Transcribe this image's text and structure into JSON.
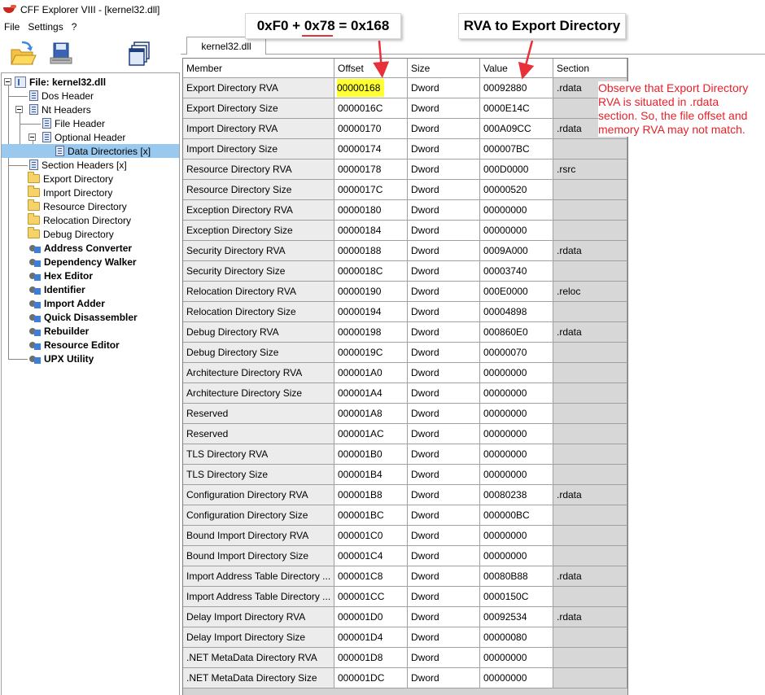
{
  "window": {
    "title": "CFF Explorer VIII - [kernel32.dll]"
  },
  "menu": [
    "File",
    "Settings",
    "?"
  ],
  "toolbar": {
    "icons": [
      "open-icon",
      "save-icon",
      "windows-icon"
    ]
  },
  "tree": {
    "root": "File: kernel32.dll",
    "items": [
      "Dos Header",
      "Nt Headers",
      "File Header",
      "Optional Header",
      "Data Directories [x]",
      "Section Headers [x]",
      "Export Directory",
      "Import Directory",
      "Resource Directory",
      "Relocation Directory",
      "Debug Directory",
      "Address Converter",
      "Dependency Walker",
      "Hex Editor",
      "Identifier",
      "Import Adder",
      "Quick Disassembler",
      "Rebuilder",
      "Resource Editor",
      "UPX Utility"
    ]
  },
  "tab": {
    "label": "kernel32.dll"
  },
  "table": {
    "columns": [
      "Member",
      "Offset",
      "Size",
      "Value",
      "Section"
    ],
    "rows": [
      [
        "Export Directory RVA",
        "00000168",
        "Dword",
        "00092880",
        ".rdata"
      ],
      [
        "Export Directory Size",
        "0000016C",
        "Dword",
        "0000E14C",
        ""
      ],
      [
        "Import Directory RVA",
        "00000170",
        "Dword",
        "000A09CC",
        ".rdata"
      ],
      [
        "Import Directory Size",
        "00000174",
        "Dword",
        "000007BC",
        ""
      ],
      [
        "Resource Directory RVA",
        "00000178",
        "Dword",
        "000D0000",
        ".rsrc"
      ],
      [
        "Resource Directory Size",
        "0000017C",
        "Dword",
        "00000520",
        ""
      ],
      [
        "Exception Directory RVA",
        "00000180",
        "Dword",
        "00000000",
        ""
      ],
      [
        "Exception Directory Size",
        "00000184",
        "Dword",
        "00000000",
        ""
      ],
      [
        "Security Directory RVA",
        "00000188",
        "Dword",
        "0009A000",
        ".rdata"
      ],
      [
        "Security Directory Size",
        "0000018C",
        "Dword",
        "00003740",
        ""
      ],
      [
        "Relocation Directory RVA",
        "00000190",
        "Dword",
        "000E0000",
        ".reloc"
      ],
      [
        "Relocation Directory Size",
        "00000194",
        "Dword",
        "00004898",
        ""
      ],
      [
        "Debug Directory RVA",
        "00000198",
        "Dword",
        "000860E0",
        ".rdata"
      ],
      [
        "Debug Directory Size",
        "0000019C",
        "Dword",
        "00000070",
        ""
      ],
      [
        "Architecture Directory RVA",
        "000001A0",
        "Dword",
        "00000000",
        ""
      ],
      [
        "Architecture Directory Size",
        "000001A4",
        "Dword",
        "00000000",
        ""
      ],
      [
        "Reserved",
        "000001A8",
        "Dword",
        "00000000",
        ""
      ],
      [
        "Reserved",
        "000001AC",
        "Dword",
        "00000000",
        ""
      ],
      [
        "TLS Directory RVA",
        "000001B0",
        "Dword",
        "00000000",
        ""
      ],
      [
        "TLS Directory Size",
        "000001B4",
        "Dword",
        "00000000",
        ""
      ],
      [
        "Configuration Directory RVA",
        "000001B8",
        "Dword",
        "00080238",
        ".rdata"
      ],
      [
        "Configuration Directory Size",
        "000001BC",
        "Dword",
        "000000BC",
        ""
      ],
      [
        "Bound Import Directory RVA",
        "000001C0",
        "Dword",
        "00000000",
        ""
      ],
      [
        "Bound Import Directory Size",
        "000001C4",
        "Dword",
        "00000000",
        ""
      ],
      [
        "Import Address Table Directory ...",
        "000001C8",
        "Dword",
        "00080B88",
        ".rdata"
      ],
      [
        "Import Address Table Directory ...",
        "000001CC",
        "Dword",
        "0000150C",
        ""
      ],
      [
        "Delay Import Directory RVA",
        "000001D0",
        "Dword",
        "00092534",
        ".rdata"
      ],
      [
        "Delay Import Directory Size",
        "000001D4",
        "Dword",
        "00000080",
        ""
      ],
      [
        ".NET MetaData Directory RVA",
        "000001D8",
        "Dword",
        "00000000",
        ""
      ],
      [
        ".NET MetaData Directory Size",
        "000001DC",
        "Dword",
        "00000000",
        ""
      ]
    ]
  },
  "annotations": {
    "formula": "0xF0 + 0x78 =  0x168",
    "rva_label": "RVA to Export Directory",
    "note": "Observe that Export Directory RVA is situated in .rdata section. So, the file offset and memory RVA may not match.",
    "highlight_color": "#ffff33",
    "arrow_color": "#e8303a",
    "note_color": "#e8202a"
  }
}
